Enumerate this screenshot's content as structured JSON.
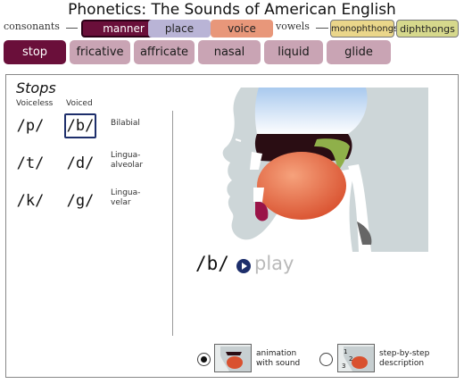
{
  "title": "Phonetics:  The Sounds of American English",
  "nav": {
    "consonants_label": "consonants",
    "vowels_label": "vowels",
    "tabs": {
      "manner": "manner",
      "place": "place",
      "voice": "voice",
      "monophthongs": "monophthongs",
      "diphthongs": "diphthongs"
    }
  },
  "subtabs": [
    "stop",
    "fricative",
    "affricate",
    "nasal",
    "liquid",
    "glide"
  ],
  "panel": {
    "heading": "Stops",
    "col_voiceless": "Voiceless",
    "col_voiced": "Voiced",
    "rows": [
      {
        "voiceless": "/p/",
        "voiced": "/b/",
        "place": [
          "Bilabial"
        ]
      },
      {
        "voiceless": "/t/",
        "voiced": "/d/",
        "place": [
          "Lingua-",
          "alveolar"
        ]
      },
      {
        "voiceless": "/k/",
        "voiced": "/g/",
        "place": [
          "Lingua-",
          "velar"
        ]
      }
    ],
    "selected_symbol": "/b/",
    "play_label": "play",
    "option_animation": [
      "animation",
      "with sound"
    ],
    "option_steps": [
      "step-by-step",
      "description"
    ]
  },
  "colors": {
    "manner_active": "#6a0f3a",
    "place_tab": "#b9b4d6",
    "voice_tab": "#e8977a",
    "monophthongs_tab": "#ead68a",
    "diphthongs_tab": "#d6d88c",
    "subtab_inactive": "#c9a4b4",
    "play_button": "#1d2e6b"
  }
}
